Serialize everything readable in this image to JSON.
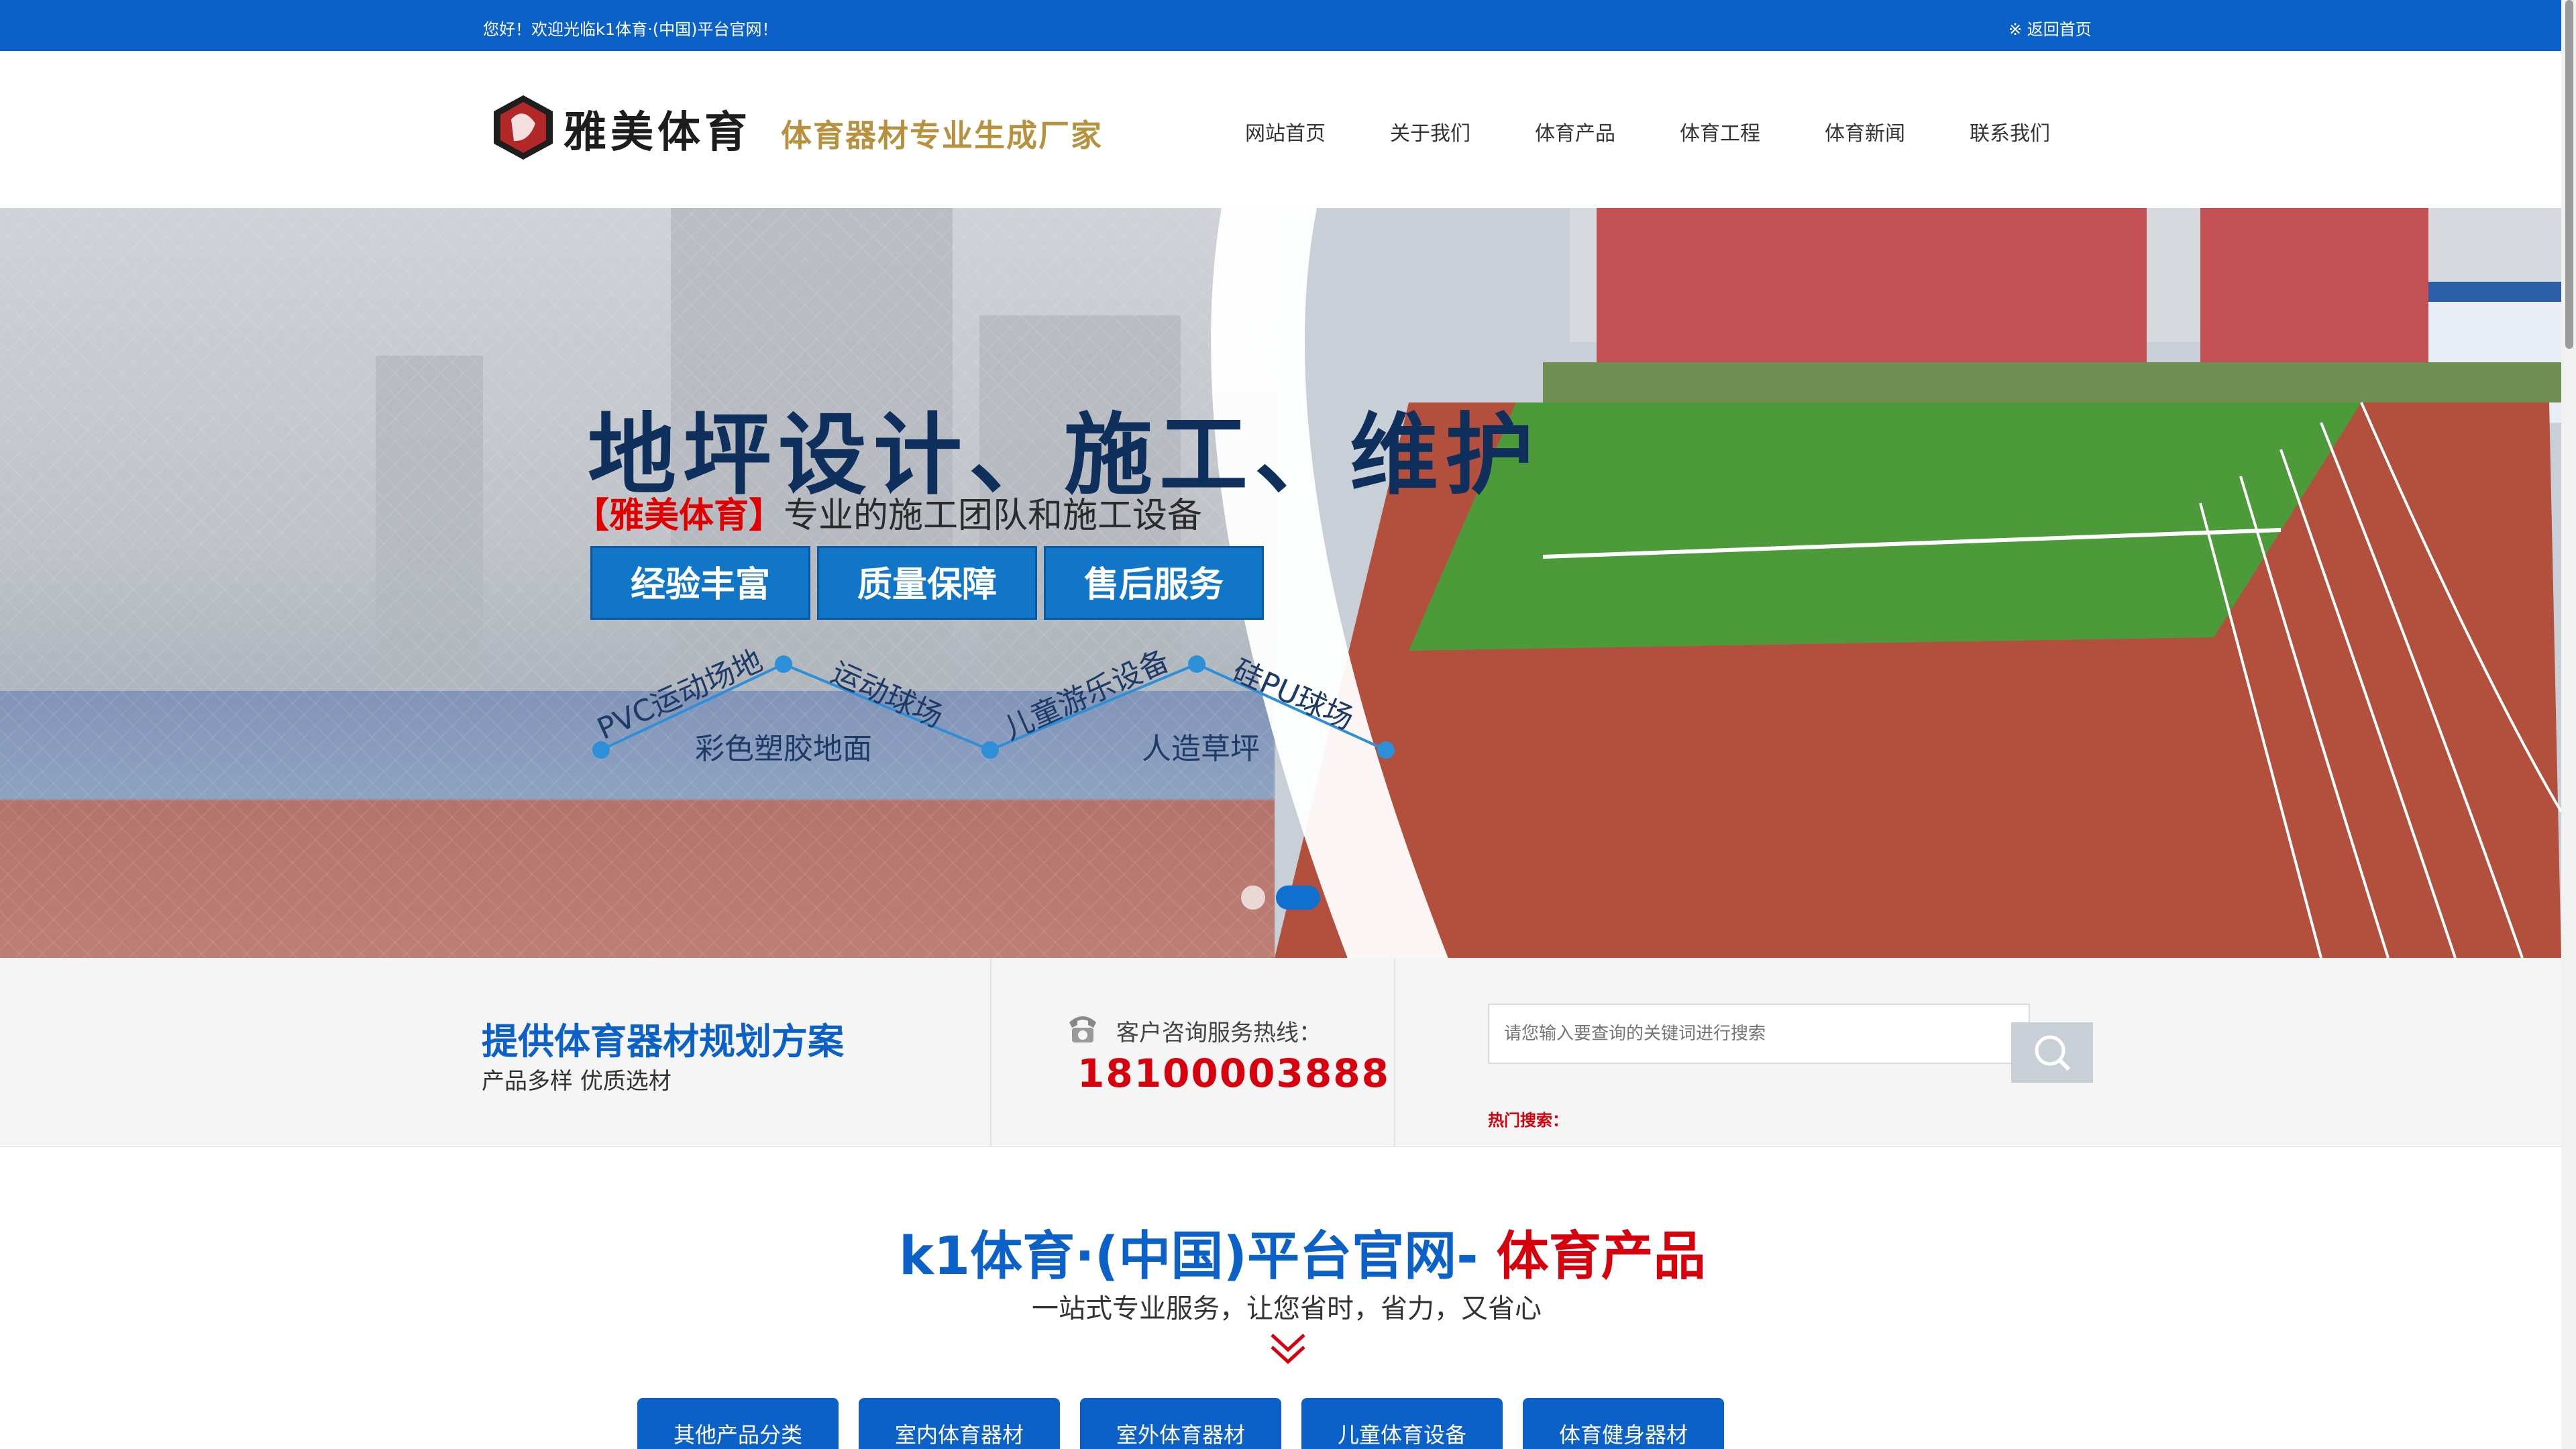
{
  "topbar": {
    "welcome": "您好！欢迎光临k1体育·(中国)平台官网！",
    "back_home": "※ 返回首页"
  },
  "header": {
    "logo_name": "雅美体育",
    "logo_slogan": "体育器材专业生成厂家",
    "nav": [
      "网站首页",
      "关于我们",
      "体育产品",
      "体育工程",
      "体育新闻",
      "联系我们"
    ]
  },
  "banner": {
    "title": "地坪设计、施工、维护",
    "subtitle_brand": "【雅美体育】",
    "subtitle_text": "专业的施工团队和施工设备",
    "tags": [
      "经验丰富",
      "质量保障",
      "售后服务"
    ],
    "features": [
      "PVC运动场地",
      "彩色塑胶地面",
      "运动球场",
      "儿童游乐设备",
      "人造草坪",
      "硅PU球场"
    ],
    "slides": 2,
    "active_slide": 2
  },
  "strip": {
    "plan_title": "提供体育器材规划方案",
    "plan_sub": "产品多样 优质选材",
    "hotline_label": "客户咨询服务热线：",
    "hotline_number": "18100003888",
    "search_placeholder": "请您输入要查询的关键词进行搜索",
    "hot_search_label": "热门搜索："
  },
  "products": {
    "title_blue": "k1体育·(中国)平台官网- ",
    "title_red": "体育产品",
    "subtitle": "一站式专业服务，让您省时，省力，又省心",
    "categories": [
      "其他产品分类",
      "室内体育器材",
      "室外体育器材",
      "儿童体育设备",
      "体育健身器材"
    ]
  },
  "colors": {
    "primary_blue": "#0c61c9",
    "accent_red": "#d8000c",
    "slogan_gold": "#b8913f"
  }
}
